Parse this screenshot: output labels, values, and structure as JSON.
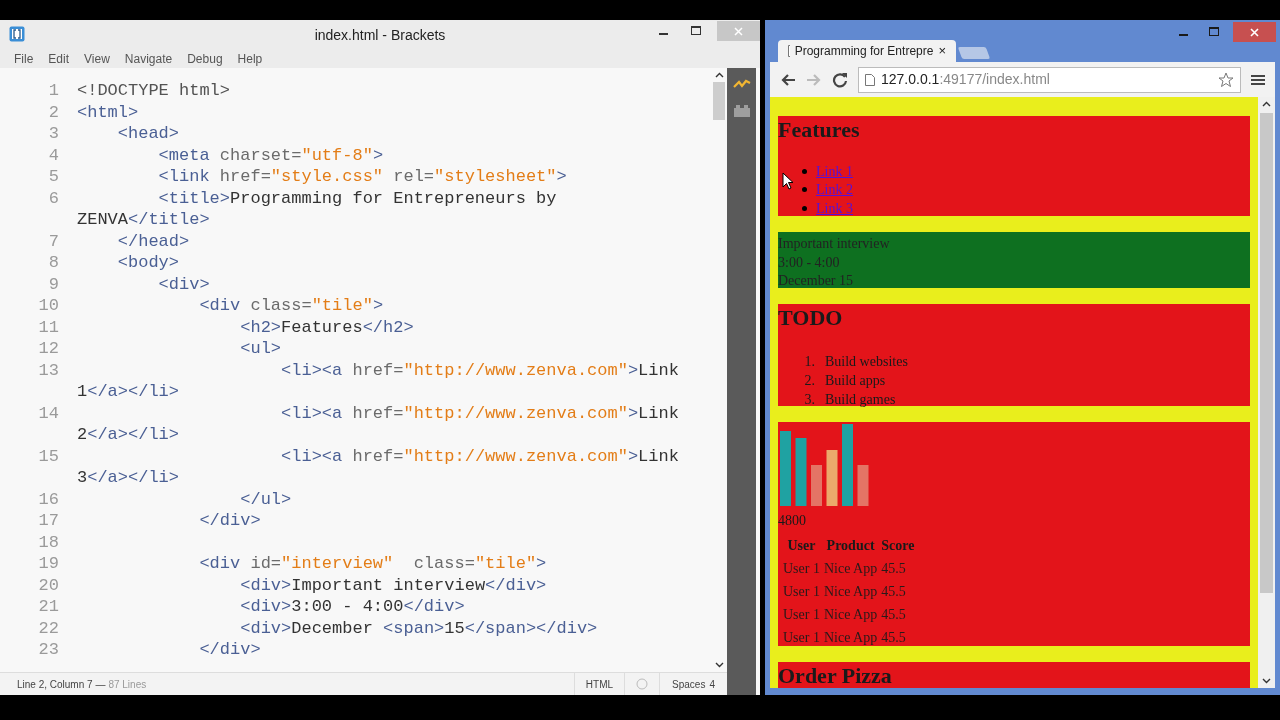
{
  "editor": {
    "title": "index.html - Brackets",
    "menu": [
      "File",
      "Edit",
      "View",
      "Navigate",
      "Debug",
      "Help"
    ],
    "rows": [
      {
        "number": "1",
        "tokens": [
          {
            "kind": "doctype",
            "text": "<!DOCTYPE html>"
          }
        ]
      },
      {
        "number": "2",
        "tokens": [
          {
            "kind": "tag",
            "text": "<html>"
          }
        ]
      },
      {
        "number": "3",
        "tokens": [
          {
            "kind": "tag",
            "text": "    <head>"
          }
        ]
      },
      {
        "number": "4",
        "tokens": [
          {
            "kind": "tag",
            "text": "        <meta"
          },
          {
            "kind": "attr",
            "text": " charset="
          },
          {
            "kind": "string",
            "text": "\"utf-8\""
          },
          {
            "kind": "tag",
            "text": ">"
          }
        ]
      },
      {
        "number": "5",
        "tokens": [
          {
            "kind": "tag",
            "text": "        <link"
          },
          {
            "kind": "attr",
            "text": " href="
          },
          {
            "kind": "string",
            "text": "\"style.css\""
          },
          {
            "kind": "attr",
            "text": " rel="
          },
          {
            "kind": "string",
            "text": "\"stylesheet\""
          },
          {
            "kind": "tag",
            "text": ">"
          }
        ]
      },
      {
        "number": "6",
        "tokens": [
          {
            "kind": "tag",
            "text": "        <title>"
          },
          {
            "kind": "text",
            "text": "Programming for Entrepreneurs by"
          }
        ]
      },
      {
        "tokens": [
          {
            "kind": "text",
            "text": "ZENVA"
          },
          {
            "kind": "tag",
            "text": "</title>"
          }
        ]
      },
      {
        "number": "7",
        "tokens": [
          {
            "kind": "tag",
            "text": "    </head>"
          }
        ]
      },
      {
        "number": "8",
        "tokens": [
          {
            "kind": "tag",
            "text": "    <body>"
          }
        ]
      },
      {
        "number": "9",
        "tokens": [
          {
            "kind": "tag",
            "text": "        <div>"
          }
        ]
      },
      {
        "number": "10",
        "tokens": [
          {
            "kind": "tag",
            "text": "            <div"
          },
          {
            "kind": "attr",
            "text": " class="
          },
          {
            "kind": "string",
            "text": "\"tile\""
          },
          {
            "kind": "tag",
            "text": ">"
          }
        ]
      },
      {
        "number": "11",
        "tokens": [
          {
            "kind": "tag",
            "text": "                <h2>"
          },
          {
            "kind": "text",
            "text": "Features"
          },
          {
            "kind": "tag",
            "text": "</h2>"
          }
        ]
      },
      {
        "number": "12",
        "tokens": [
          {
            "kind": "tag",
            "text": "                <ul>"
          }
        ]
      },
      {
        "number": "13",
        "tokens": [
          {
            "kind": "tag",
            "text": "                    <li><a"
          },
          {
            "kind": "attr",
            "text": " href="
          },
          {
            "kind": "string",
            "text": "\"http://www.zenva.com\""
          },
          {
            "kind": "tag",
            "text": ">"
          },
          {
            "kind": "text",
            "text": "Link"
          }
        ]
      },
      {
        "tokens": [
          {
            "kind": "text",
            "text": "1"
          },
          {
            "kind": "tag",
            "text": "</a></li>"
          }
        ]
      },
      {
        "number": "14",
        "tokens": [
          {
            "kind": "tag",
            "text": "                    <li><a"
          },
          {
            "kind": "attr",
            "text": " href="
          },
          {
            "kind": "string",
            "text": "\"http://www.zenva.com\""
          },
          {
            "kind": "tag",
            "text": ">"
          },
          {
            "kind": "text",
            "text": "Link"
          }
        ]
      },
      {
        "tokens": [
          {
            "kind": "text",
            "text": "2"
          },
          {
            "kind": "tag",
            "text": "</a></li>"
          }
        ]
      },
      {
        "number": "15",
        "tokens": [
          {
            "kind": "tag",
            "text": "                    <li><a"
          },
          {
            "kind": "attr",
            "text": " href="
          },
          {
            "kind": "string",
            "text": "\"http://www.zenva.com\""
          },
          {
            "kind": "tag",
            "text": ">"
          },
          {
            "kind": "text",
            "text": "Link"
          }
        ]
      },
      {
        "tokens": [
          {
            "kind": "text",
            "text": "3"
          },
          {
            "kind": "tag",
            "text": "</a></li>"
          }
        ]
      },
      {
        "number": "16",
        "tokens": [
          {
            "kind": "tag",
            "text": "                </ul>"
          }
        ]
      },
      {
        "number": "17",
        "tokens": [
          {
            "kind": "tag",
            "text": "            </div>"
          }
        ]
      },
      {
        "number": "18",
        "tokens": []
      },
      {
        "number": "19",
        "tokens": [
          {
            "kind": "tag",
            "text": "            <div"
          },
          {
            "kind": "attr",
            "text": " id="
          },
          {
            "kind": "string",
            "text": "\"interview\""
          },
          {
            "kind": "attr",
            "text": "  class="
          },
          {
            "kind": "string",
            "text": "\"tile\""
          },
          {
            "kind": "tag",
            "text": ">"
          }
        ]
      },
      {
        "number": "20",
        "tokens": [
          {
            "kind": "tag",
            "text": "                <div>"
          },
          {
            "kind": "text",
            "text": "Important interview"
          },
          {
            "kind": "tag",
            "text": "</div>"
          }
        ]
      },
      {
        "number": "21",
        "tokens": [
          {
            "kind": "tag",
            "text": "                <div>"
          },
          {
            "kind": "text",
            "text": "3:00 - 4:00"
          },
          {
            "kind": "tag",
            "text": "</div>"
          }
        ]
      },
      {
        "number": "22",
        "tokens": [
          {
            "kind": "tag",
            "text": "                <div>"
          },
          {
            "kind": "text",
            "text": "December "
          },
          {
            "kind": "tag",
            "text": "<span>"
          },
          {
            "kind": "text",
            "text": "15"
          },
          {
            "kind": "tag",
            "text": "</span></div>"
          }
        ]
      },
      {
        "number": "23",
        "tokens": [
          {
            "kind": "tag",
            "text": "            </div>"
          }
        ]
      }
    ],
    "status": {
      "position": "Line 2, Column 7 —",
      "line_count": "87 Lines",
      "language": "HTML",
      "indent_label": "Spaces",
      "indent_size": "4"
    }
  },
  "browser": {
    "tab": {
      "title": "Programming for Entrepre",
      "close": "×"
    },
    "address": {
      "host": "127.0.0.1",
      "path": ":49177/index.html"
    },
    "tiles": [
      {
        "kind": "links",
        "color": "#e3141a",
        "heading": "Features",
        "items": [
          "Link 1",
          "Link 2",
          "Link 3"
        ]
      },
      {
        "kind": "lines",
        "color": "#0e7020",
        "lines": [
          "Important interview",
          "3:00 - 4:00",
          "December 15"
        ]
      },
      {
        "kind": "ordered",
        "color": "#e3141a",
        "heading": "TODO",
        "items": [
          {
            "marker": "1.",
            "text": "Build websites"
          },
          {
            "marker": "2.",
            "text": "Build apps"
          },
          {
            "marker": "3.",
            "text": "Build games"
          }
        ]
      },
      {
        "kind": "stats",
        "color": "#e3141a",
        "caption": "4800",
        "columns": [
          "User",
          "Product",
          "Score"
        ],
        "rows": [
          [
            "User 1",
            "Nice App",
            "45.5"
          ],
          [
            "User 1",
            "Nice App",
            "45.5"
          ],
          [
            "User 1",
            "Nice App",
            "45.5"
          ],
          [
            "User 1",
            "Nice App",
            "45.5"
          ]
        ]
      },
      {
        "kind": "heading",
        "color": "#e3141a",
        "heading": "Order Pizza"
      }
    ]
  }
}
